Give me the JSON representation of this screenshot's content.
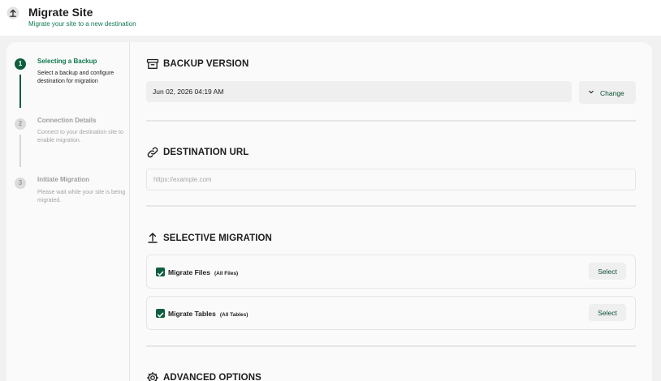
{
  "header": {
    "title": "Migrate Site",
    "subtitle": "Migrate your site to a new destination"
  },
  "steps": [
    {
      "number": "1",
      "title": "Selecting a Backup",
      "description": "Select a backup and configure destination for migration",
      "state": "active"
    },
    {
      "number": "2",
      "title": "Connection Details",
      "description": "Connect to your destination site to enable migration.",
      "state": "pending"
    },
    {
      "number": "3",
      "title": "Initiate Migration",
      "description": "Please wait while your site is being migrated.",
      "state": "pending"
    }
  ],
  "backup_version": {
    "title": "BACKUP VERSION",
    "selected": "Jun 02, 2026 04:19 AM",
    "change_label": "Change"
  },
  "destination_url": {
    "title": "DESTINATION URL",
    "placeholder": "https://example.com",
    "value": ""
  },
  "selective_migration": {
    "title": "SELECTIVE MIGRATION",
    "items": [
      {
        "label": "Migrate Files",
        "sub": "(All Files)",
        "checked": true,
        "select_label": "Select"
      },
      {
        "label": "Migrate Tables",
        "sub": "(All Tables)",
        "checked": true,
        "select_label": "Select"
      }
    ]
  },
  "advanced_options": {
    "title": "ADVANCED OPTIONS"
  },
  "colors": {
    "accent": "#0f7a4e",
    "accent_dark": "#0f5e3e",
    "background": "#f1f1f1",
    "panel": "#fafafa"
  },
  "icons": {
    "header": "upload-arrow-icon",
    "backup_version": "archive-box-icon",
    "destination_url": "link-icon",
    "selective_migration": "upload-arrow-icon",
    "advanced_options": "gear-icon",
    "change": "chevron-down-icon",
    "checkbox": "check-icon"
  }
}
